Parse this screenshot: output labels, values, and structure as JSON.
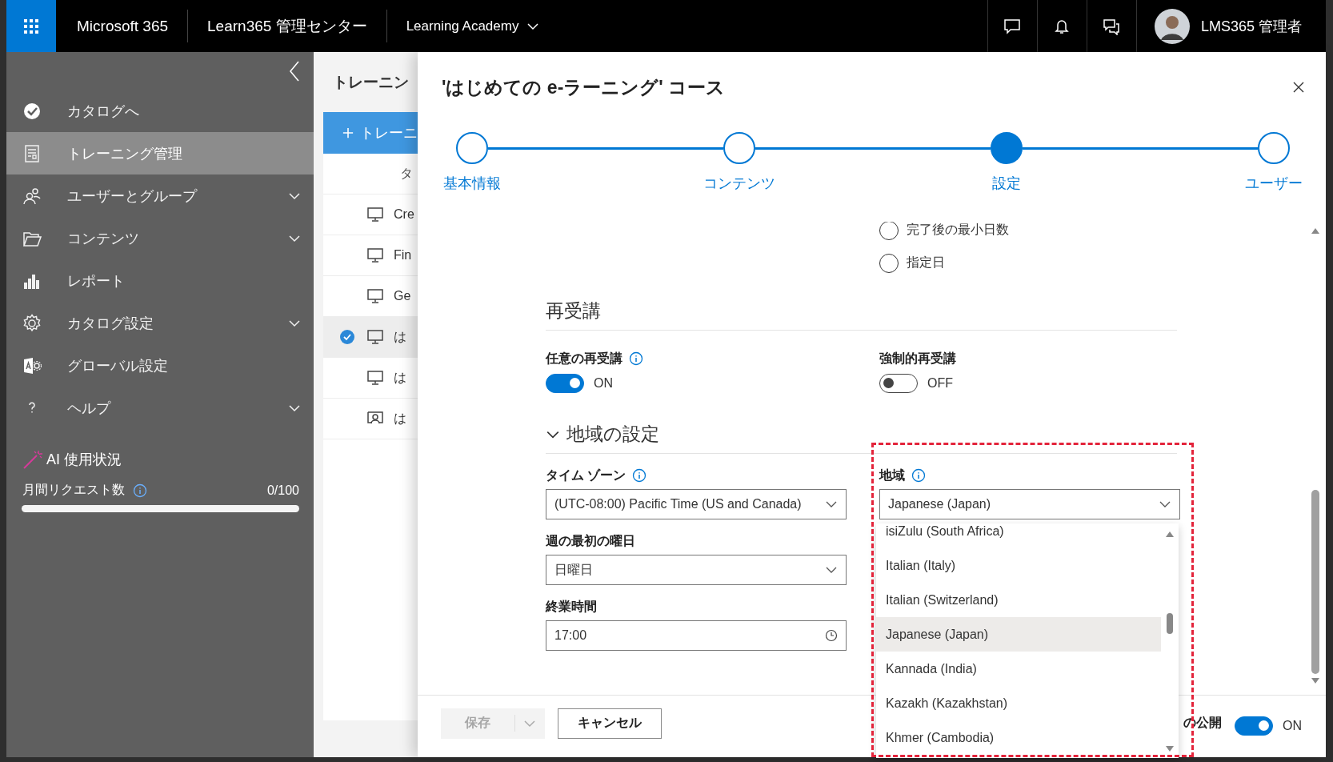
{
  "topbar": {
    "app_name": "Microsoft 365",
    "center_name": "Learn365 管理センター",
    "tenant": "Learning Academy",
    "user_name": "LMS365 管理者"
  },
  "sidebar": {
    "items": [
      {
        "label": "カタログへ",
        "kind": "check",
        "selected": false,
        "expandable": false
      },
      {
        "label": "トレーニング管理",
        "kind": "document",
        "selected": true,
        "expandable": false
      },
      {
        "label": "ユーザーとグループ",
        "kind": "people",
        "selected": false,
        "expandable": true
      },
      {
        "label": "コンテンツ",
        "kind": "folder",
        "selected": false,
        "expandable": true
      },
      {
        "label": "レポート",
        "kind": "chart",
        "selected": false,
        "expandable": false
      },
      {
        "label": "カタログ設定",
        "kind": "gear",
        "selected": false,
        "expandable": true
      },
      {
        "label": "グローバル設定",
        "kind": "global",
        "selected": false,
        "expandable": false
      },
      {
        "label": "ヘルプ",
        "kind": "help",
        "selected": false,
        "expandable": true
      }
    ],
    "ai_usage": {
      "title": "AI 使用状況",
      "metric_label": "月間リクエスト数",
      "count": "0/100",
      "level": 0
    }
  },
  "background_page": {
    "title": "トレーニン",
    "new_button": "トレーニ",
    "column_1": "タ",
    "rows": [
      {
        "kind": "monitor",
        "title": "Cre",
        "selected": false
      },
      {
        "kind": "monitor",
        "title": "Fin",
        "selected": false
      },
      {
        "kind": "monitor",
        "title": "Ge",
        "selected": false
      },
      {
        "kind": "monitor",
        "title": "は",
        "selected": true
      },
      {
        "kind": "monitor",
        "title": "は",
        "selected": false
      },
      {
        "kind": "classroom",
        "title": "は",
        "selected": false
      }
    ]
  },
  "panel": {
    "title": "'はじめての e-ラーニング' コース",
    "steps": [
      {
        "label": "基本情報",
        "selected": false
      },
      {
        "label": "コンテンツ",
        "selected": false
      },
      {
        "label": "設定",
        "selected": true
      },
      {
        "label": "ユーザー",
        "selected": false
      }
    ],
    "completion_options": [
      {
        "label": "完了後の最小日数",
        "selected": false
      },
      {
        "label": "指定日",
        "selected": false
      }
    ],
    "retake": {
      "heading": "再受講",
      "toggles": [
        {
          "label": "任意の再受講",
          "info": true,
          "on": true,
          "state_text": "ON"
        },
        {
          "label": "強制的再受講",
          "info": false,
          "on": false,
          "state_text": "OFF"
        }
      ]
    },
    "regional": {
      "heading": "地域の設定",
      "expanded": true,
      "fields": [
        {
          "kind": "select",
          "label": "タイム ゾーン",
          "info": true,
          "value": "(UTC-08:00) Pacific Time (US and Canada)"
        },
        {
          "kind": "select",
          "label": "地域",
          "info": true,
          "value": "Japanese (Japan)"
        },
        {
          "kind": "select",
          "label": "週の最初の曜日",
          "info": false,
          "value": "日曜日"
        },
        {
          "kind": "spacer"
        },
        {
          "kind": "time",
          "label": "終業時間",
          "info": false,
          "value": "17:00"
        }
      ]
    },
    "region_options": [
      {
        "label": "isiZulu (South Africa)",
        "selected": false
      },
      {
        "label": "Italian (Italy)",
        "selected": false
      },
      {
        "label": "Italian (Switzerland)",
        "selected": false
      },
      {
        "label": "Japanese (Japan)",
        "selected": true
      },
      {
        "label": "Kannada (India)",
        "selected": false
      },
      {
        "label": "Kazakh (Kazakhstan)",
        "selected": false
      },
      {
        "label": "Khmer (Cambodia)",
        "selected": false
      }
    ],
    "footer": {
      "save_button": "保存",
      "save_disabled": true,
      "cancel_button": "キャンセル",
      "publish_label": "の公開",
      "publish_on": true,
      "publish_state_text": "ON"
    }
  }
}
